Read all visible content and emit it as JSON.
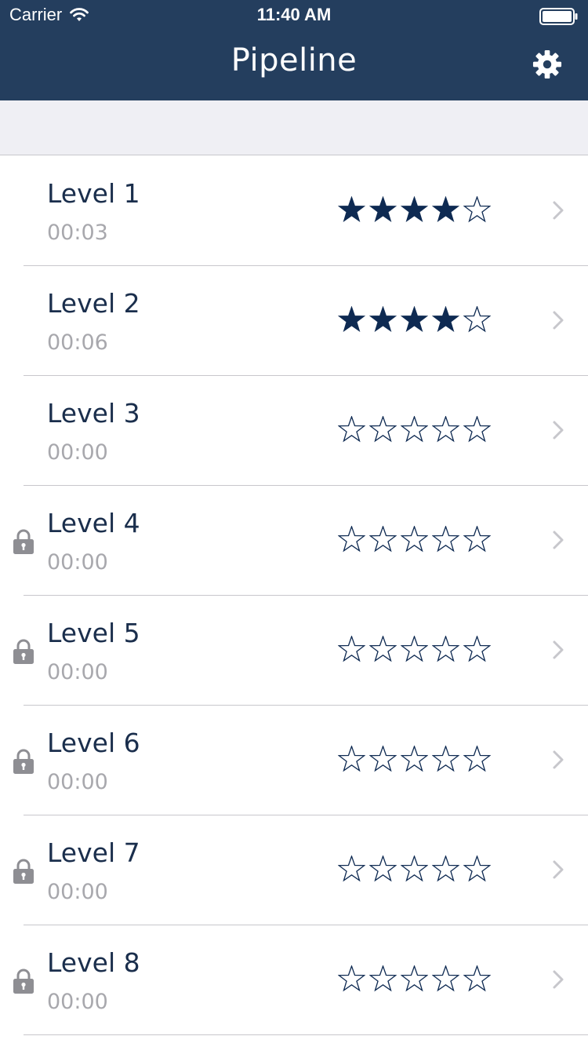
{
  "status_bar": {
    "carrier": "Carrier",
    "time": "11:40 AM",
    "wifi_icon": "wifi-icon",
    "battery_icon": "battery-icon"
  },
  "nav": {
    "title": "Pipeline",
    "settings_icon": "gear-icon",
    "background_color": "#243e5e"
  },
  "colors": {
    "accent": "#0e2a52",
    "secondary_text": "#a8a8ad",
    "lock": "#8e8e93",
    "chevron": "#c7c7cc",
    "section_background": "#efeff4"
  },
  "levels": [
    {
      "name": "Level 1",
      "time": "00:03",
      "stars": 4,
      "max_stars": 5,
      "locked": false
    },
    {
      "name": "Level 2",
      "time": "00:06",
      "stars": 4,
      "max_stars": 5,
      "locked": false
    },
    {
      "name": "Level 3",
      "time": "00:00",
      "stars": 0,
      "max_stars": 5,
      "locked": false
    },
    {
      "name": "Level 4",
      "time": "00:00",
      "stars": 0,
      "max_stars": 5,
      "locked": true
    },
    {
      "name": "Level 5",
      "time": "00:00",
      "stars": 0,
      "max_stars": 5,
      "locked": true
    },
    {
      "name": "Level 6",
      "time": "00:00",
      "stars": 0,
      "max_stars": 5,
      "locked": true
    },
    {
      "name": "Level 7",
      "time": "00:00",
      "stars": 0,
      "max_stars": 5,
      "locked": true
    },
    {
      "name": "Level 8",
      "time": "00:00",
      "stars": 0,
      "max_stars": 5,
      "locked": true
    }
  ]
}
